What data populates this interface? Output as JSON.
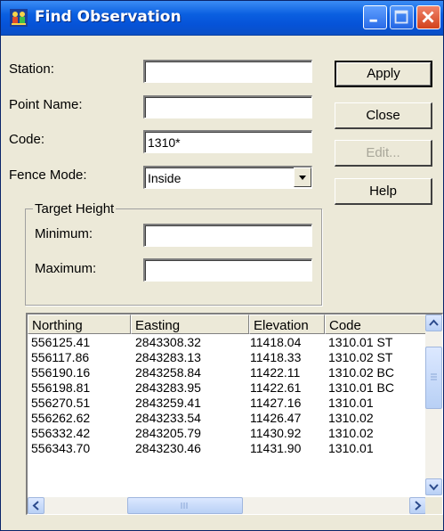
{
  "window": {
    "title": "Find Observation",
    "icons": {
      "app": "people-app-icon",
      "minimize": "minimize-icon",
      "maximize": "maximize-icon",
      "close": "close-icon"
    }
  },
  "form": {
    "station_label": "Station:",
    "station_value": "",
    "point_name_label": "Point Name:",
    "point_name_value": "",
    "code_label": "Code:",
    "code_value": "1310*",
    "fence_mode_label": "Fence Mode:",
    "fence_mode_value": "Inside",
    "target_height_title": "Target Height",
    "minimum_label": "Minimum:",
    "minimum_value": "",
    "maximum_label": "Maximum:",
    "maximum_value": ""
  },
  "buttons": {
    "apply": "Apply",
    "close": "Close",
    "edit": "Edit...",
    "help": "Help"
  },
  "table": {
    "columns": [
      "Northing",
      "Easting",
      "Elevation",
      "Code"
    ],
    "rows": [
      [
        "556125.41",
        "2843308.32",
        "11418.04",
        "1310.01 ST"
      ],
      [
        "556117.86",
        "2843283.13",
        "11418.33",
        "1310.02 ST"
      ],
      [
        "556190.16",
        "2843258.84",
        "11422.11",
        "1310.02 BC"
      ],
      [
        "556198.81",
        "2843283.95",
        "11422.61",
        "1310.01 BC"
      ],
      [
        "556270.51",
        "2843259.41",
        "11427.16",
        "1310.01"
      ],
      [
        "556262.62",
        "2843233.54",
        "11426.47",
        "1310.02"
      ],
      [
        "556332.42",
        "2843205.79",
        "11430.92",
        "1310.02"
      ],
      [
        "556343.70",
        "2843230.46",
        "11431.90",
        "1310.01"
      ]
    ]
  }
}
